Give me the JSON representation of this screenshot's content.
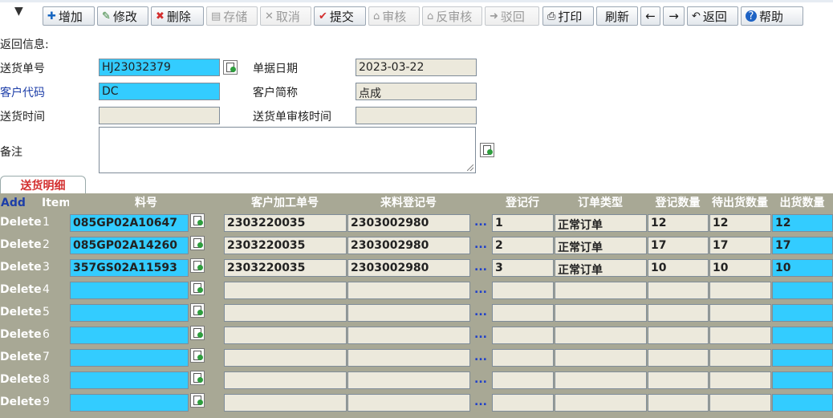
{
  "toolbar": {
    "buttons": [
      {
        "label": "增加",
        "icon": "plus-icon",
        "enabled": true
      },
      {
        "label": "修改",
        "icon": "edit-icon",
        "enabled": true
      },
      {
        "label": "删除",
        "icon": "delete-icon",
        "enabled": true
      },
      {
        "label": "存储",
        "icon": "save-icon",
        "enabled": false
      },
      {
        "label": "取消",
        "icon": "cancel-icon",
        "enabled": false
      },
      {
        "label": "提交",
        "icon": "check-icon",
        "enabled": true
      },
      {
        "label": "审核",
        "icon": "approve-icon",
        "enabled": false
      },
      {
        "label": "反审核",
        "icon": "unapprove-icon",
        "enabled": false
      },
      {
        "label": "驳回",
        "icon": "reject-icon",
        "enabled": false
      },
      {
        "label": "打印",
        "icon": "print-icon",
        "enabled": true
      },
      {
        "label": "刷新",
        "icon": "",
        "enabled": true
      },
      {
        "label": "←",
        "icon": "",
        "enabled": true
      },
      {
        "label": "→",
        "icon": "",
        "enabled": true
      },
      {
        "label": "返回",
        "icon": "undo-icon",
        "enabled": true
      },
      {
        "label": "帮助",
        "icon": "help-icon",
        "enabled": true
      }
    ]
  },
  "form": {
    "return_info_label": "返回信息:",
    "delivery_no_label": "送货单号",
    "delivery_no": "HJ23032379",
    "doc_date_label": "单据日期",
    "doc_date": "2023-03-22",
    "customer_code_label": "客户代码",
    "customer_code": "DC",
    "customer_short_label": "客户简称",
    "customer_short": "点成",
    "delivery_time_label": "送货时间",
    "delivery_time": "",
    "audit_time_label": "送货单审核时间",
    "audit_time": "",
    "remark_label": "备注",
    "remark": ""
  },
  "tab": {
    "label": "送货明细"
  },
  "grid": {
    "add_label": "Add",
    "delete_label": "Delete",
    "dots_label": "...",
    "headers": [
      "Item",
      "料号",
      "客户加工单号",
      "来料登记号",
      "",
      "登记行",
      "订单类型",
      "登记数量",
      "待出货数量",
      "出货数量"
    ],
    "rows": [
      {
        "item": "1",
        "part": "085GP02A10647",
        "cust_order": "2303220035",
        "reg_no": "2303002980",
        "reg_line": "1",
        "order_type": "正常订单",
        "reg_qty": "12",
        "pending_qty": "12",
        "ship_qty": "12"
      },
      {
        "item": "2",
        "part": "085GP02A14260",
        "cust_order": "2303220035",
        "reg_no": "2303002980",
        "reg_line": "2",
        "order_type": "正常订单",
        "reg_qty": "17",
        "pending_qty": "17",
        "ship_qty": "17"
      },
      {
        "item": "3",
        "part": "357GS02A11593",
        "cust_order": "2303220035",
        "reg_no": "2303002980",
        "reg_line": "3",
        "order_type": "正常订单",
        "reg_qty": "10",
        "pending_qty": "10",
        "ship_qty": "10"
      },
      {
        "item": "4",
        "part": "",
        "cust_order": "",
        "reg_no": "",
        "reg_line": "",
        "order_type": "",
        "reg_qty": "",
        "pending_qty": "",
        "ship_qty": ""
      },
      {
        "item": "5",
        "part": "",
        "cust_order": "",
        "reg_no": "",
        "reg_line": "",
        "order_type": "",
        "reg_qty": "",
        "pending_qty": "",
        "ship_qty": ""
      },
      {
        "item": "6",
        "part": "",
        "cust_order": "",
        "reg_no": "",
        "reg_line": "",
        "order_type": "",
        "reg_qty": "",
        "pending_qty": "",
        "ship_qty": ""
      },
      {
        "item": "7",
        "part": "",
        "cust_order": "",
        "reg_no": "",
        "reg_line": "",
        "order_type": "",
        "reg_qty": "",
        "pending_qty": "",
        "ship_qty": ""
      },
      {
        "item": "8",
        "part": "",
        "cust_order": "",
        "reg_no": "",
        "reg_line": "",
        "order_type": "",
        "reg_qty": "",
        "pending_qty": "",
        "ship_qty": ""
      },
      {
        "item": "9",
        "part": "",
        "cust_order": "",
        "reg_no": "",
        "reg_line": "",
        "order_type": "",
        "reg_qty": "",
        "pending_qty": "",
        "ship_qty": ""
      }
    ]
  },
  "colors": {
    "field_blue": "#33ccff",
    "field_gray": "#ece9dc",
    "grid_bg": "#a8a895",
    "link_blue": "#1d3ea8",
    "tab_red": "#d32f2f"
  }
}
